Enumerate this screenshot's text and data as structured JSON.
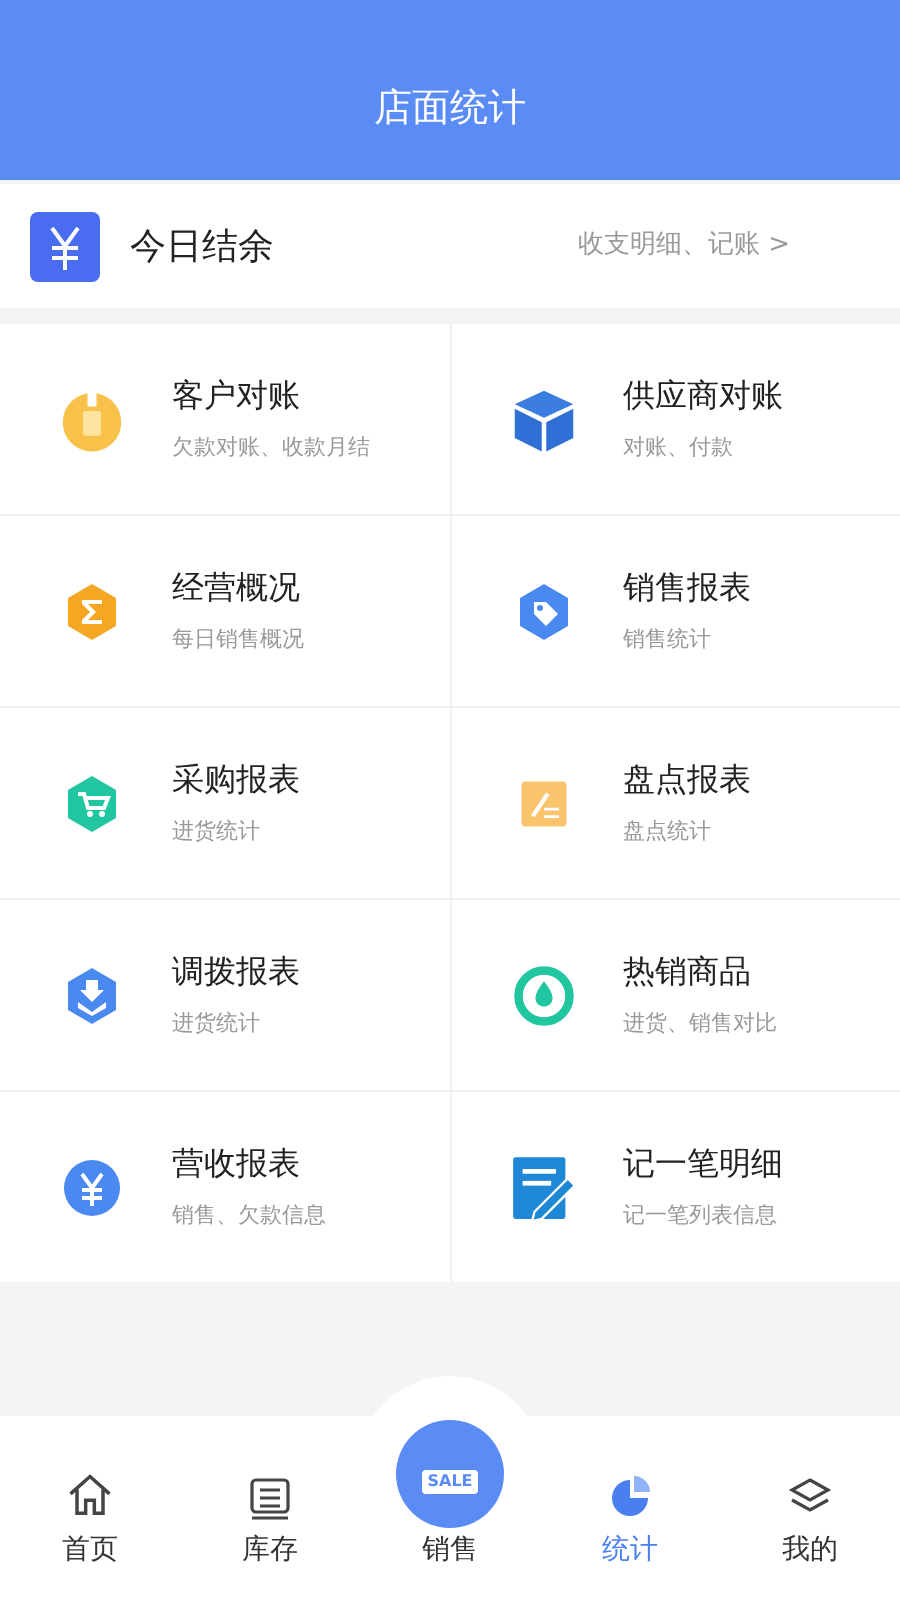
{
  "header": {
    "title": "店面统计"
  },
  "balance": {
    "title": "今日结余",
    "link": "收支明细、记账 >"
  },
  "items": [
    {
      "kind": "customer",
      "title": "客户对账",
      "subtitle": "欠款对账、收款月结"
    },
    {
      "kind": "supplier",
      "title": "供应商对账",
      "subtitle": "对账、付款"
    },
    {
      "kind": "overview",
      "title": "经营概况",
      "subtitle": "每日销售概况"
    },
    {
      "kind": "sales",
      "title": "销售报表",
      "subtitle": "销售统计"
    },
    {
      "kind": "purchase",
      "title": "采购报表",
      "subtitle": "进货统计"
    },
    {
      "kind": "stocktake",
      "title": "盘点报表",
      "subtitle": "盘点统计"
    },
    {
      "kind": "transfer",
      "title": "调拨报表",
      "subtitle": "进货统计"
    },
    {
      "kind": "hot",
      "title": "热销商品",
      "subtitle": "进货、销售对比"
    },
    {
      "kind": "revenue",
      "title": "营收报表",
      "subtitle": "销售、欠款信息"
    },
    {
      "kind": "note",
      "title": "记一笔明细",
      "subtitle": "记一笔列表信息"
    }
  ],
  "tabs": [
    {
      "kind": "home",
      "label": "首页",
      "selected": false
    },
    {
      "kind": "stock",
      "label": "库存",
      "selected": false
    },
    {
      "kind": "sale",
      "label": "销售",
      "badge": "SALE",
      "selected": false
    },
    {
      "kind": "stats",
      "label": "统计",
      "selected": true
    },
    {
      "kind": "mine",
      "label": "我的",
      "selected": false
    }
  ]
}
